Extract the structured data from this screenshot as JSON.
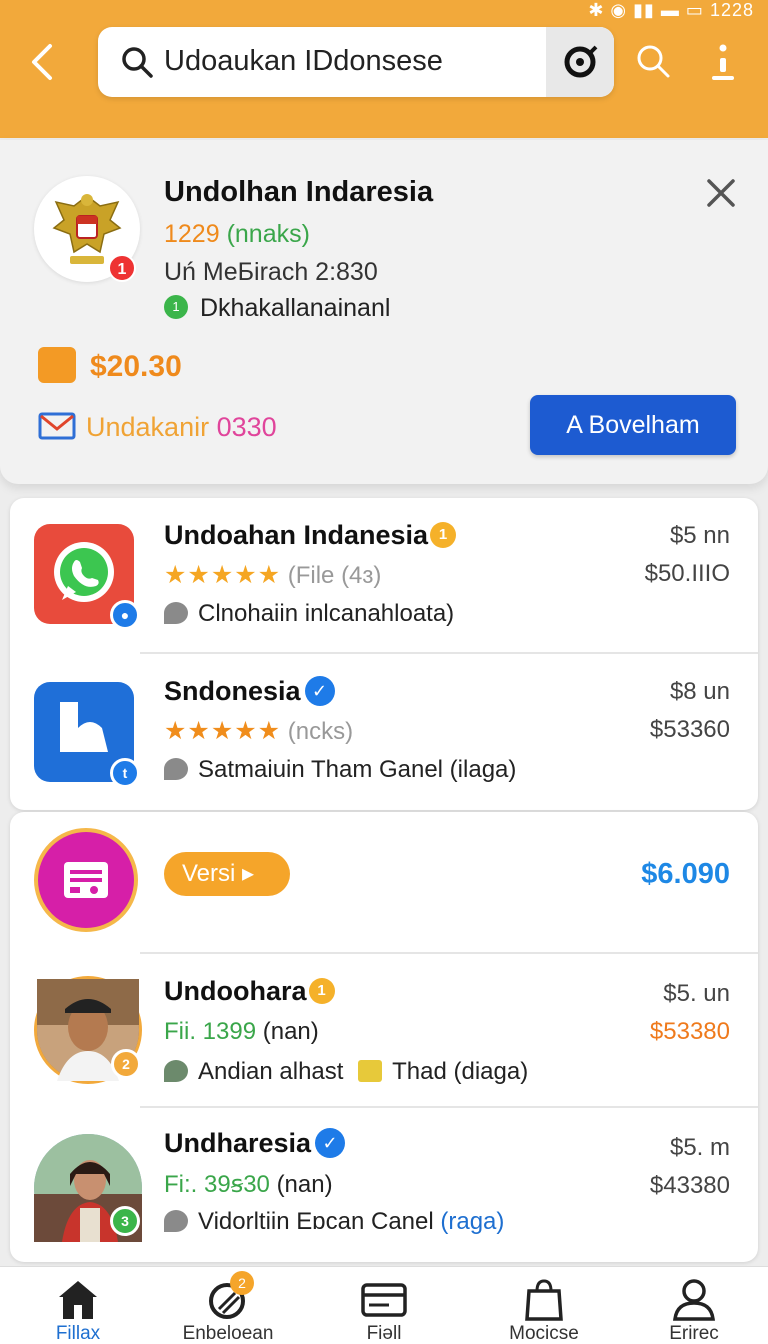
{
  "status_bar": {
    "time": "1228"
  },
  "header": {
    "search_text": "Udoaukan IDdonsese"
  },
  "profile": {
    "title": "Undolhan Indaresia",
    "count": "1229",
    "count_label": "(nnaks)",
    "meta": "Uń MeБirach 2:830",
    "status": "Dkhakallanainanl",
    "avatar_badge": "1",
    "price": "$20.30",
    "mail_label": "Undakanir",
    "mail_number": "0330",
    "button_label": "A Bovelham"
  },
  "list": [
    {
      "title": "Undoahan Indanesia",
      "title_badge": "1",
      "rating_text": "(File (4ɜ)",
      "desc": "Clnohaiin inlcanahloata)",
      "price1": "$5  nn",
      "price2": "$50.IIIO"
    },
    {
      "title": "Sndonesia",
      "rating_text": "(ncks)",
      "desc": "Satmaiuin Tham Ganel (ilaga)",
      "price1": "$8  un",
      "price2": "$53360"
    },
    {
      "chip_label": "Versi ▸",
      "price": "$6.090"
    },
    {
      "title": "Undoohara",
      "title_badge": "1",
      "sub_green": "Fii. 1399",
      "sub_rest": "(nan)",
      "desc_a": "Andian alhast",
      "desc_b": "Thad (diaga)",
      "avatar_badge": "2",
      "price1": "$5. un",
      "price2": "$53380"
    },
    {
      "title": "Undharesia",
      "sub_green": "Fi:. 39ꞩ30",
      "sub_rest": "(nan)",
      "desc": "Vidorltiin Eɒcan Canel",
      "desc_blue": "(raga)",
      "avatar_badge": "3",
      "price1": "$5. m",
      "price2": "$43380"
    }
  ],
  "nav": [
    {
      "label": "Fillax",
      "badge": ""
    },
    {
      "label": "Enbeloean",
      "badge": "2"
    },
    {
      "label": "Fiəll",
      "badge": ""
    },
    {
      "label": "Mocicse",
      "badge": ""
    },
    {
      "label": "Erirec",
      "badge": ""
    }
  ],
  "colors": {
    "header": "#f2a93b",
    "accent_orange": "#ef8a1c",
    "primary_blue": "#1d5bd1",
    "verified_blue": "#1e7be8",
    "green": "#3aa64a"
  },
  "icons": {
    "back": "chevron-left-icon",
    "search": "search-icon",
    "mic": "voice-icon",
    "more": "more-vert-icon",
    "close": "close-icon",
    "mail": "mail-icon",
    "thumb": "thumbs-up-icon",
    "whatsapp": "whatsapp-icon",
    "app_blue": "app-icon",
    "radio": "radio-icon",
    "verified": "verified-icon",
    "star": "star-icon",
    "comment": "comment-icon",
    "home": "home-icon",
    "store": "store-icon",
    "card": "card-icon",
    "bag": "shopping-bag-icon",
    "person": "person-icon"
  }
}
